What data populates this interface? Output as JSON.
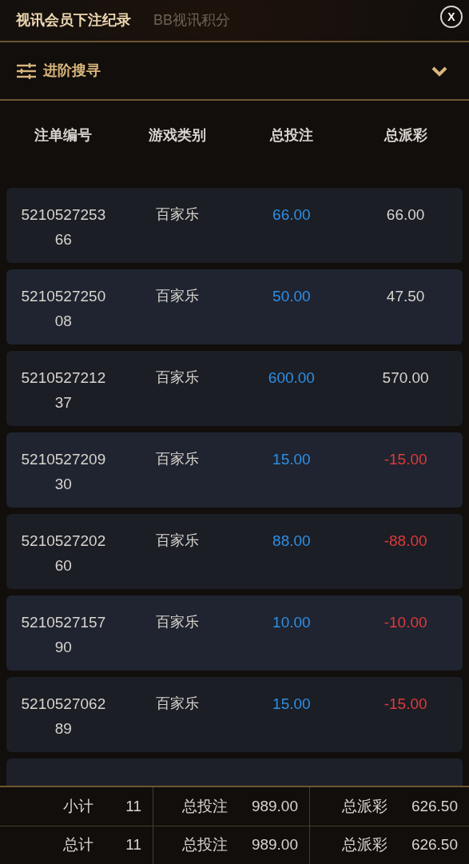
{
  "tabs": [
    {
      "label": "视讯会员下注纪录",
      "selected": true
    },
    {
      "label": "BB视讯积分",
      "selected": false
    }
  ],
  "close_button": {
    "label": "X"
  },
  "advanced_search": {
    "label": "进阶搜寻",
    "expanded": false
  },
  "table": {
    "columns": [
      "注单编号",
      "游戏类别",
      "总投注",
      "总派彩"
    ],
    "rows": [
      {
        "order_no": "521052725366",
        "game": "百家乐",
        "bet": "66.00",
        "payout": "66.00",
        "loss": false
      },
      {
        "order_no": "521052725008",
        "game": "百家乐",
        "bet": "50.00",
        "payout": "47.50",
        "loss": false
      },
      {
        "order_no": "521052721237",
        "game": "百家乐",
        "bet": "600.00",
        "payout": "570.00",
        "loss": false
      },
      {
        "order_no": "521052720930",
        "game": "百家乐",
        "bet": "15.00",
        "payout": "-15.00",
        "loss": true
      },
      {
        "order_no": "521052720260",
        "game": "百家乐",
        "bet": "88.00",
        "payout": "-88.00",
        "loss": true
      },
      {
        "order_no": "521052715790",
        "game": "百家乐",
        "bet": "10.00",
        "payout": "-10.00",
        "loss": true
      },
      {
        "order_no": "521052706289",
        "game": "百家乐",
        "bet": "15.00",
        "payout": "-15.00",
        "loss": true
      }
    ]
  },
  "summary": [
    {
      "label": "小计",
      "count": "11",
      "bet_label": "总投注",
      "bet": "989.00",
      "payout_label": "总派彩",
      "payout": "626.50"
    },
    {
      "label": "总计",
      "count": "11",
      "bet_label": "总投注",
      "bet": "989.00",
      "payout_label": "总派彩",
      "payout": "626.50"
    }
  ]
}
